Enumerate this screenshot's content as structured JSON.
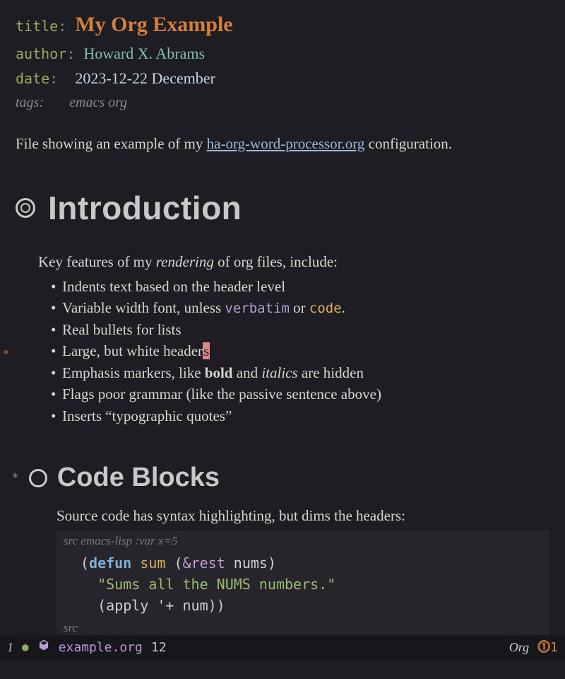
{
  "meta": {
    "title_key": "title",
    "title_val": "My Org Example",
    "author_key": "author",
    "author_val": "Howard X. Abrams",
    "date_key": "date",
    "date_val": "2023-12-22 December",
    "tags_key": "tags:",
    "tags_val": "emacs org"
  },
  "intro_para": {
    "pre": "File showing an example of my ",
    "link": "ha-org-word-processor.org",
    "post": " configuration."
  },
  "h1": "Introduction",
  "features_lead_pre": "Key features of my ",
  "features_lead_ital": "rendering",
  "features_lead_post": " of org files, include:",
  "features": {
    "f0": "Indents text based on the header level",
    "f1_pre": "Variable width font, unless ",
    "f1_verb": "verbatim",
    "f1_mid": " or ",
    "f1_code": "code",
    "f1_post": ".",
    "f2": "Real bullets for lists",
    "f3_pre": "Large, but white header",
    "f3_cursor": "s",
    "f4_pre": "Emphasis markers, like ",
    "f4_bold": "bold",
    "f4_mid": " and ",
    "f4_ital": "italics",
    "f4_post": " are hidden",
    "f5": "Flags poor grammar (like the passive sentence above)",
    "f6": "Inserts “typographic quotes”"
  },
  "h2_star": "*",
  "h2": "Code Blocks",
  "src_intro": "Source code has syntax highlighting, but dims the headers:",
  "src_header": "src emacs-lisp :var x=5",
  "src_footer": "src",
  "code": {
    "l1_open": "(",
    "l1_defun": "defun",
    "l1_sp": " ",
    "l1_fn": "sum",
    "l1_args_open": " (",
    "l1_amp": "&rest",
    "l1_nums": " nums",
    "l1_close": ")",
    "l2": "  \"Sums all the NUMS numbers.\"",
    "l3": "  (apply '+ num))"
  },
  "modeline": {
    "win_num": "1",
    "filename": "example.org",
    "position": "12",
    "mode": "Org",
    "warn_count": "1"
  }
}
